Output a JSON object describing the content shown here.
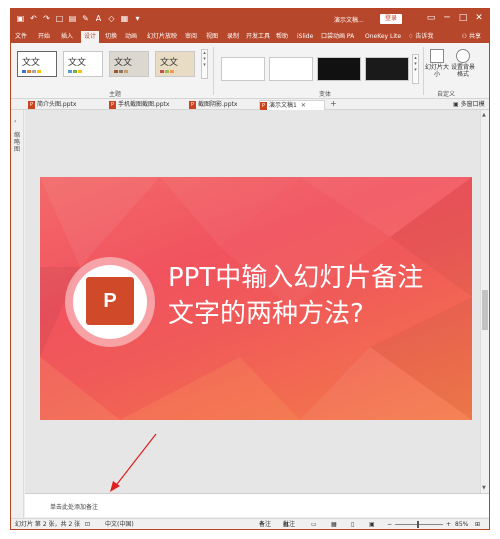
{
  "titlebar": {
    "doc_title": "演示文稿...",
    "login": "登录",
    "qat_icons": [
      "save-icon",
      "undo-icon",
      "redo-icon",
      "new-icon",
      "open-icon"
    ]
  },
  "tabs": [
    "文件",
    "开始",
    "插入",
    "设计",
    "切换",
    "动画",
    "幻灯片放映",
    "审阅",
    "视图",
    "录制",
    "开发工具",
    "帮助",
    "iSlide",
    "口袋动画 PA",
    "OneKey Lite",
    "告诉我"
  ],
  "active_tab": "设计",
  "share": "共享",
  "ribbon": {
    "theme_thumb_text": "文文",
    "group_theme": "主题",
    "group_variant": "变体",
    "group_custom": "自定义",
    "btn_slide_size": "幻灯片大小",
    "btn_bg_format": "设置背景格式"
  },
  "doc_tabs": [
    {
      "label": "简介头图.pptx",
      "active": false
    },
    {
      "label": "手机截图截图.pptx",
      "active": false
    },
    {
      "label": "截图阴影.pptx",
      "active": false
    },
    {
      "label": "演示文稿1",
      "active": true
    }
  ],
  "multi_window": "多窗口模式",
  "rail_label": "缩略图",
  "slide": {
    "title_line1": "PPT中输入幻灯片备注",
    "title_line2": "文字的两种方法?",
    "logo_letter": "P"
  },
  "notes_placeholder": "单击此处添加备注",
  "status": {
    "slide_info": "幻灯片 第 2 张，共 2 张",
    "language": "中文(中国)",
    "notes_btn": "备注",
    "comments_btn": "批注",
    "zoom": "85%"
  },
  "colors": {
    "accent": "#b7472a",
    "slide_grad_start": "#f26a6a",
    "slide_grad_end": "#f57c4a",
    "annotation_arrow": "#e02020"
  }
}
